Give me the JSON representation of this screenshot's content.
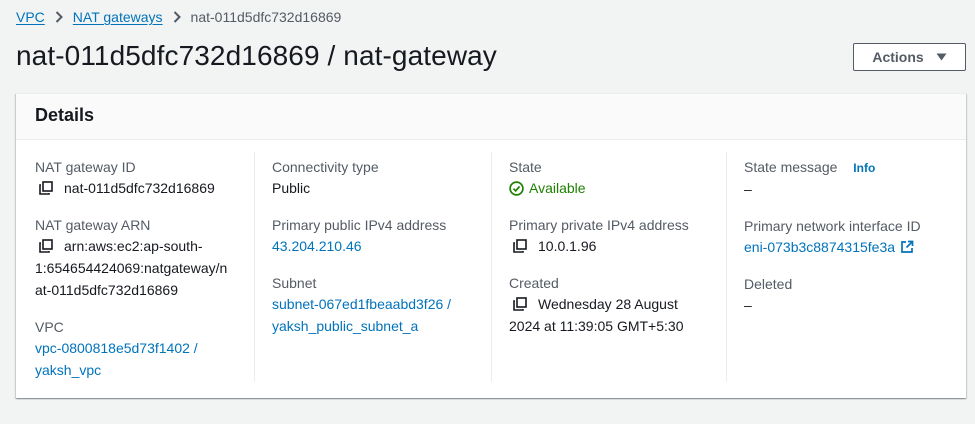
{
  "breadcrumb": {
    "vpc": "VPC",
    "nat_gateways": "NAT gateways",
    "current": "nat-011d5dfc732d16869"
  },
  "page_title": "nat-011d5dfc732d16869 / nat-gateway",
  "actions_label": "Actions",
  "details": {
    "title": "Details",
    "col1": {
      "nat_gateway_id_label": "NAT gateway ID",
      "nat_gateway_id": "nat-011d5dfc732d16869",
      "nat_gateway_arn_label": "NAT gateway ARN",
      "nat_gateway_arn_line1": "arn:aws:ec2:ap-south-",
      "nat_gateway_arn_line2": "1:654654424069:natgateway/n",
      "nat_gateway_arn_line3": "at-011d5dfc732d16869",
      "vpc_label": "VPC",
      "vpc_line1": "vpc-0800818e5d73f1402 /",
      "vpc_line2": "yaksh_vpc"
    },
    "col2": {
      "connectivity_label": "Connectivity type",
      "connectivity": "Public",
      "public_ip_label": "Primary public IPv4 address",
      "public_ip": "43.204.210.46",
      "subnet_label": "Subnet",
      "subnet_line1": "subnet-067ed1fbeaabd3f26 /",
      "subnet_line2": "yaksh_public_subnet_a"
    },
    "col3": {
      "state_label": "State",
      "state": "Available",
      "private_ip_label": "Primary private IPv4 address",
      "private_ip": "10.0.1.96",
      "created_label": "Created",
      "created_line1": "Wednesday 28 August",
      "created_line2": "2024 at 11:39:05 GMT+5:30"
    },
    "col4": {
      "state_message_label": "State message",
      "info_label": "Info",
      "state_message": "–",
      "eni_label": "Primary network interface ID",
      "eni": "eni-073b3c8874315fe3a",
      "deleted_label": "Deleted",
      "deleted": "–"
    }
  },
  "colors": {
    "link": "#0073bb",
    "success": "#1d8102",
    "text": "#16191f",
    "label": "#545b64",
    "background": "#f2f3f3"
  },
  "icons": {
    "breadcrumb_separator": "chevron-right-icon",
    "actions_caret": "caret-down-icon",
    "copy": "copy-icon",
    "status": "check-circle-icon",
    "external": "external-link-icon"
  }
}
